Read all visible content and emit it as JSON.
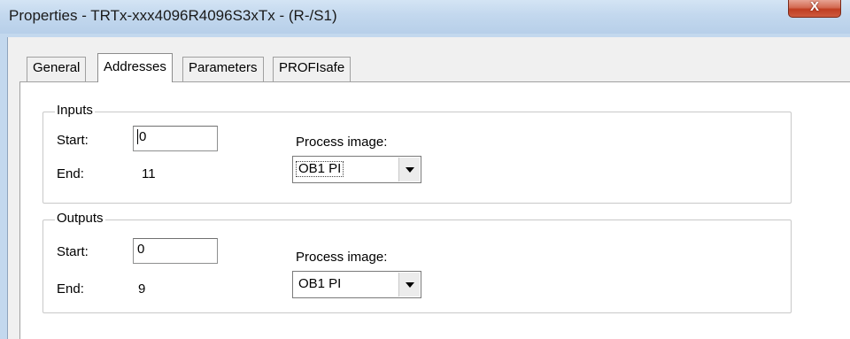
{
  "window": {
    "title": "Properties - TRTx-xxx4096R4096S3xTx - (R-/S1)",
    "close_label": "X"
  },
  "tabs": [
    {
      "label": "General",
      "active": false
    },
    {
      "label": "Addresses",
      "active": true
    },
    {
      "label": "Parameters",
      "active": false
    },
    {
      "label": "PROFIsafe",
      "active": false
    }
  ],
  "inputs": {
    "legend": "Inputs",
    "start_label": "Start:",
    "start_value": "0",
    "end_label": "End:",
    "end_value": "11",
    "process_image_label": "Process image:",
    "process_image_value": "OB1 PI"
  },
  "outputs": {
    "legend": "Outputs",
    "start_label": "Start:",
    "start_value": "0",
    "end_label": "End:",
    "end_value": "9",
    "process_image_label": "Process image:",
    "process_image_value": "OB1 PI"
  }
}
